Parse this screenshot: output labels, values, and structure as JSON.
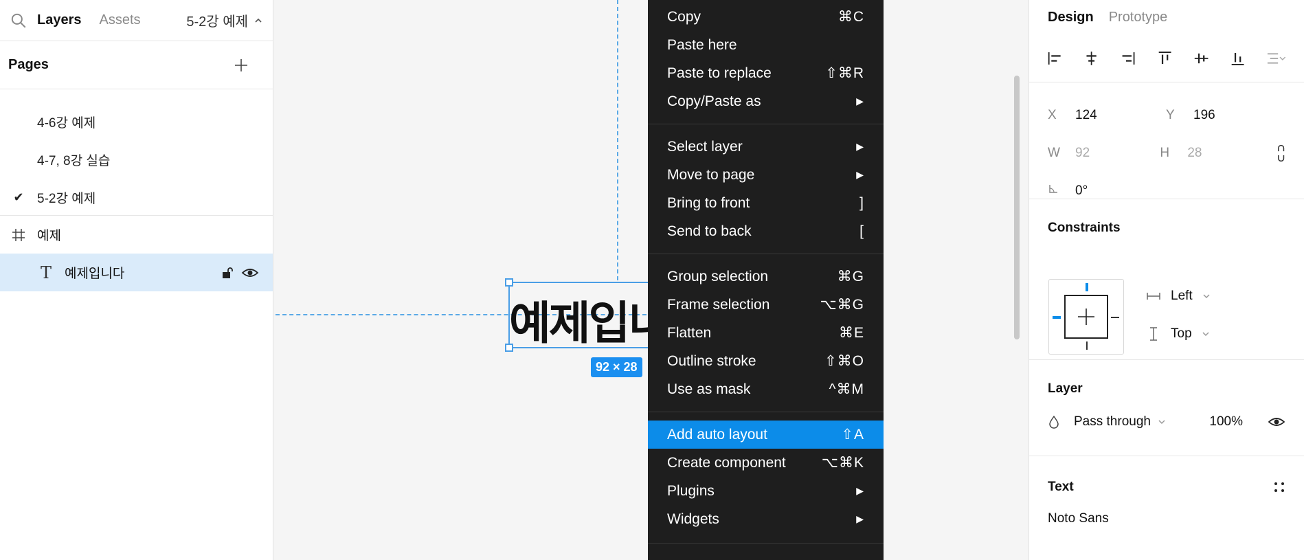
{
  "left_panel": {
    "tab_layers": "Layers",
    "tab_assets": "Assets",
    "current_page": "5-2강 예제",
    "pages_title": "Pages",
    "pages": [
      {
        "label": "4-6강 예제",
        "active": false
      },
      {
        "label": "4-7, 8강 실습",
        "active": false
      },
      {
        "label": "5-2강 예제",
        "active": true
      }
    ],
    "layers": {
      "frame_label": "예제",
      "text_layer_label": "예제입니다"
    }
  },
  "canvas": {
    "text_content": "예제입니",
    "dimensions_badge": "92 × 28"
  },
  "context_menu": {
    "groups": [
      [
        {
          "label": "Copy",
          "shortcut": "⌘C"
        },
        {
          "label": "Paste here",
          "shortcut": ""
        },
        {
          "label": "Paste to replace",
          "shortcut": "⇧⌘R"
        },
        {
          "label": "Copy/Paste as",
          "shortcut": "▶"
        }
      ],
      [
        {
          "label": "Select layer",
          "shortcut": "▶"
        },
        {
          "label": "Move to page",
          "shortcut": "▶"
        },
        {
          "label": "Bring to front",
          "shortcut": "]"
        },
        {
          "label": "Send to back",
          "shortcut": "["
        }
      ],
      [
        {
          "label": "Group selection",
          "shortcut": "⌘G"
        },
        {
          "label": "Frame selection",
          "shortcut": "⌥⌘G"
        },
        {
          "label": "Flatten",
          "shortcut": "⌘E"
        },
        {
          "label": "Outline stroke",
          "shortcut": "⇧⌘O"
        },
        {
          "label": "Use as mask",
          "shortcut": "^⌘M"
        }
      ],
      [
        {
          "label": "Add auto layout",
          "shortcut": "⇧A",
          "highlighted": true
        },
        {
          "label": "Create component",
          "shortcut": "⌥⌘K"
        },
        {
          "label": "Plugins",
          "shortcut": "▶"
        },
        {
          "label": "Widgets",
          "shortcut": "▶"
        }
      ]
    ]
  },
  "right_panel": {
    "tab_design": "Design",
    "tab_prototype": "Prototype",
    "x_label": "X",
    "x_value": "124",
    "y_label": "Y",
    "y_value": "196",
    "w_label": "W",
    "w_value": "92",
    "h_label": "H",
    "h_value": "28",
    "rotation_value": "0°",
    "constraints_title": "Constraints",
    "constraint_h": "Left",
    "constraint_v": "Top",
    "layer_title": "Layer",
    "blend_mode": "Pass through",
    "opacity": "100%",
    "text_title": "Text",
    "font_family": "Noto Sans"
  },
  "colors": {
    "accent": "#0c8ce9",
    "menu_bg": "#1e1e1e",
    "selection": "#4a9ee6",
    "layer_selected_bg": "#daebfa"
  }
}
